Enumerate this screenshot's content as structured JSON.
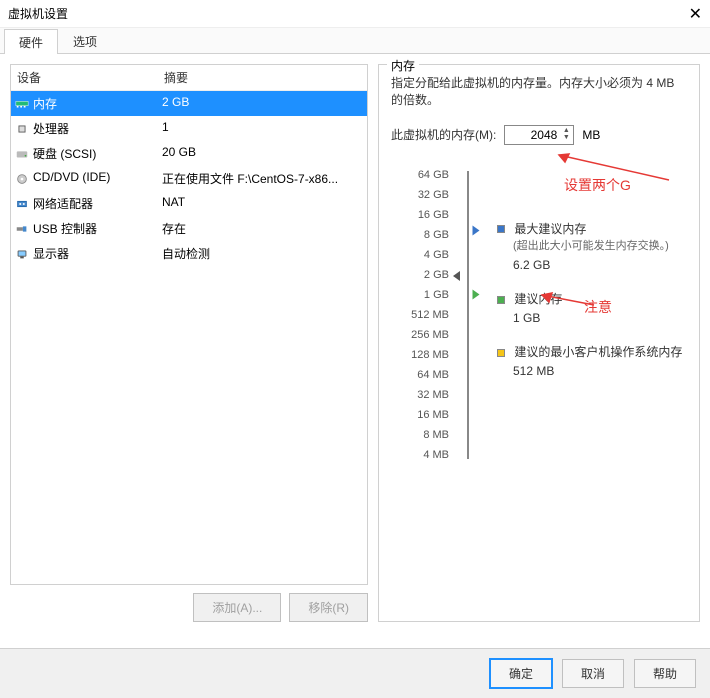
{
  "window": {
    "title": "虚拟机设置"
  },
  "tabs": {
    "hardware": "硬件",
    "options": "选项"
  },
  "devlist": {
    "head_dev": "设备",
    "head_sum": "摘要",
    "rows": [
      {
        "name": "内存",
        "summary": "2 GB"
      },
      {
        "name": "处理器",
        "summary": "1"
      },
      {
        "name": "硬盘 (SCSI)",
        "summary": "20 GB"
      },
      {
        "name": "CD/DVD (IDE)",
        "summary": "正在使用文件 F:\\CentOS-7-x86..."
      },
      {
        "name": "网络适配器",
        "summary": "NAT"
      },
      {
        "name": "USB 控制器",
        "summary": "存在"
      },
      {
        "name": "显示器",
        "summary": "自动检测"
      }
    ],
    "add_btn": "添加(A)...",
    "remove_btn": "移除(R)"
  },
  "mem": {
    "title": "内存",
    "desc": "指定分配给此虚拟机的内存量。内存大小必须为 4 MB 的倍数。",
    "label": "此虚拟机的内存(M):",
    "value": "2048",
    "unit": "MB",
    "scale": [
      "64 GB",
      "32 GB",
      "16 GB",
      "8 GB",
      "4 GB",
      "2 GB",
      "1 GB",
      "512 MB",
      "256 MB",
      "128 MB",
      "64 MB",
      "32 MB",
      "16 MB",
      "8 MB",
      "4 MB"
    ],
    "max_rec_t": "最大建议内存",
    "max_rec_d": "(超出此大小可能发生内存交换。)",
    "max_rec_v": "6.2 GB",
    "rec_t": "建议内存",
    "rec_v": "1 GB",
    "min_rec_t": "建议的最小客户机操作系统内存",
    "min_rec_v": "512 MB"
  },
  "annot": {
    "set2g": "设置两个G",
    "note": "注意"
  },
  "footer": {
    "ok": "确定",
    "cancel": "取消",
    "help": "帮助"
  }
}
